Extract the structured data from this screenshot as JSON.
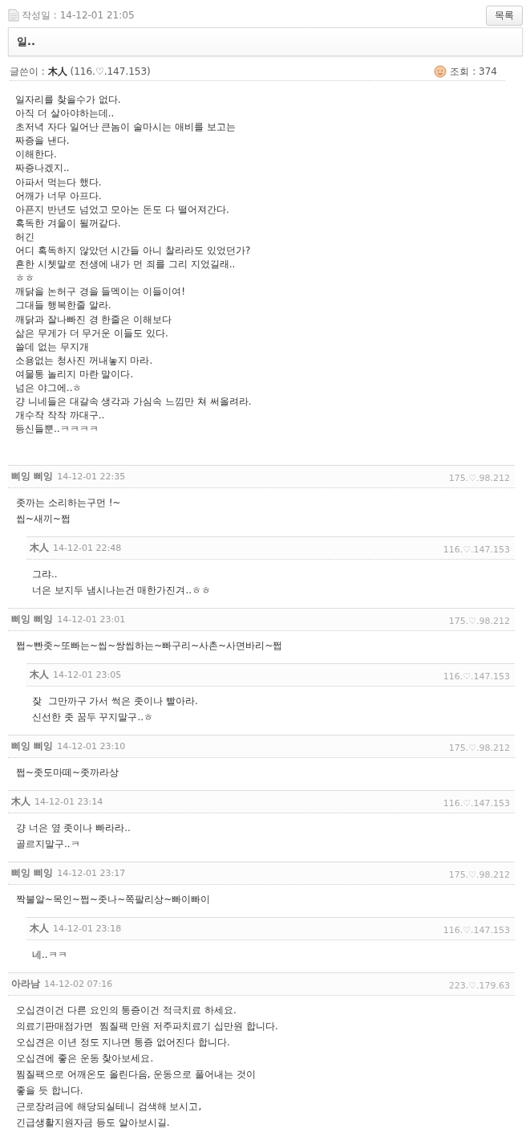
{
  "post": {
    "date_label": "작성일 : 14-12-01 21:05",
    "list_button": "목록",
    "title": "일..",
    "author_label": "글쓴이 : ",
    "author": "木人",
    "author_ip": "(116.♡.147.153)",
    "views": "조회 : 374",
    "body": [
      "일자리를 찾을수가 없다.",
      "아직 더 살아야하는데..",
      "초저녁 자다 일어난 큰놈이 술마시는 애비를 보고는",
      "짜증을 낸다.",
      "이해한다.",
      "짜증나겠지..",
      "아파서 먹는다 했다.",
      "어깨가 너무 아프다.",
      "아픈지 반년도 넘었고 모아논 돈도 다 떨어져간다.",
      "혹독한 겨울이 될꺼같다.",
      "허긴",
      "어디 혹독하지 않았던 시간들 아니 찰라라도 있었던가?",
      "흔한 시쳇말로 전생에 내가 먼 죄를 그리 지었길래..",
      "ㅎㅎ",
      "깨닭을 논허구 경을 들멕이는 이들이여!",
      "그대들 행복한줄 알라.",
      "깨닭과 잘나빠진 경 한줄은 이해보다",
      "삶은 무게가 더 무거운 이들도 있다.",
      "쓸데 없는 무지개",
      "소용없는 청사진 꺼내놓지 마라.",
      "여물통 놀리지 마란 말이다.",
      "넘은 야그에..ㅎ",
      "걍 니네들은 대갈속 생각과 가심속 느낌만 쳐 써올려라.",
      "개수작 작작 까대구..",
      "등신들뿐..ㅋㅋㅋㅋ"
    ]
  },
  "comments": [
    {
      "name": "삐잉 삐잉",
      "date": "14-12-01 22:35",
      "ip": "175.♡.98.212",
      "lines": [
        "좃까는 소리하는구먼 !~",
        "씹~새끼~쩝"
      ],
      "children": [
        {
          "name": "木人",
          "date": "14-12-01 22:48",
          "ip": "116.♡.147.153",
          "lines": [
            "그랴..",
            "너은 보지두 냄시나는건 매한가진겨..ㅎㅎ"
          ]
        }
      ]
    },
    {
      "name": "삐잉 삐잉",
      "date": "14-12-01 23:01",
      "ip": "175.♡.98.212",
      "lines": [
        "쩝~빤좃~또빠는~씹~쌍씹하는~빠구리~사촌~사면바리~쩝"
      ],
      "children": [
        {
          "name": "木人",
          "date": "14-12-01 23:05",
          "ip": "116.♡.147.153",
          "lines": [
            "잦  그만까구 가서 썩은 좃이나 빨아라.",
            "신선한 좃 꿈두 꾸지말구..ㅎ"
          ]
        }
      ]
    },
    {
      "name": "삐잉 삐잉",
      "date": "14-12-01 23:10",
      "ip": "175.♡.98.212",
      "lines": [
        "쩝~좃도마떼~좃까라상"
      ]
    },
    {
      "name": "木人",
      "date": "14-12-01 23:14",
      "ip": "116.♡.147.153",
      "lines": [
        "걍 너은 옆 좃이나 빠라라..",
        "골르지말구..ㅋ"
      ]
    },
    {
      "name": "삐잉 삐잉",
      "date": "14-12-01 23:17",
      "ip": "175.♡.98.212",
      "lines": [
        "짝불알~목인~쩝~좃나~쪽팔리상~빠이빠이"
      ],
      "children": [
        {
          "name": "木人",
          "date": "14-12-01 23:18",
          "ip": "116.♡.147.153",
          "lines": [
            "네..ㅋㅋ"
          ]
        }
      ]
    },
    {
      "name": "아라남",
      "date": "14-12-02 07:16",
      "ip": "223.♡.179.63",
      "lines": [
        "오십견이건 다른 요인의 통증이건 적극치료 하세요.",
        "의료기판매점가면  찜질팩 만원 저주파치료기 십만원 합니다.",
        "오십견은 이년 정도 지나면 통증 없어진다 합니다.",
        "오십견에 좋은 운동 찾아보세요.",
        "찜질팩으로 어깨온도 올린다음, 운동으로 풀어내는 것이",
        "좋을 듯 합니다.",
        "근로장려금에 해당되실테니 검색해 보시고,",
        "긴급생활지원자금 등도 알아보시길."
      ]
    }
  ]
}
